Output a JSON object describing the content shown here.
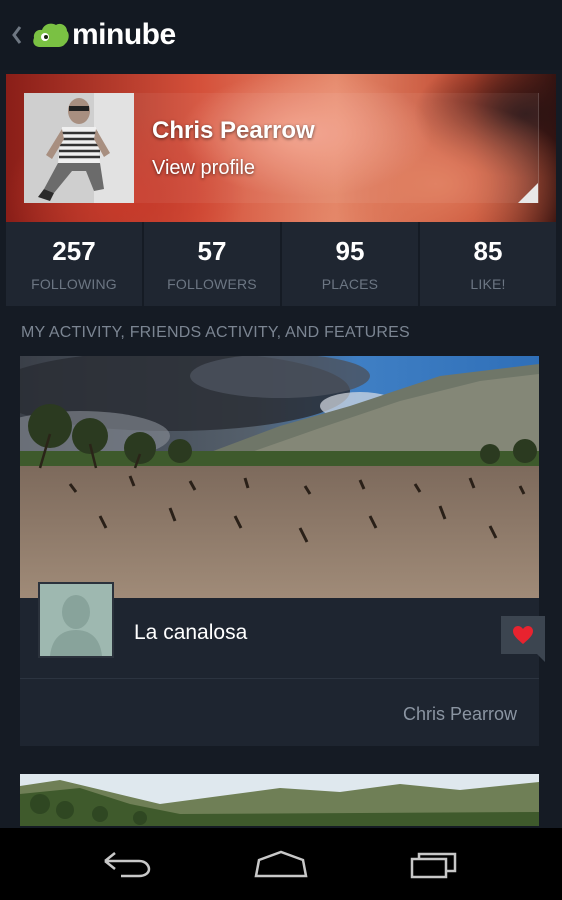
{
  "app": {
    "logo_text": "minube",
    "brand_color": "#7ac143"
  },
  "profile": {
    "name": "Chris Pearrow",
    "view_profile_label": "View profile"
  },
  "stats": [
    {
      "value": "257",
      "label": "FOLLOWING"
    },
    {
      "value": "57",
      "label": "FOLLOWERS"
    },
    {
      "value": "95",
      "label": "PLACES"
    },
    {
      "value": "85",
      "label": "LIKE!"
    }
  ],
  "section": {
    "header": "MY ACTIVITY, FRIENDS ACTIVITY, AND FEATURES"
  },
  "activity": [
    {
      "place": "La canalosa",
      "author": "Chris Pearrow",
      "liked": true,
      "like_color": "#e8232f"
    }
  ],
  "nav": {
    "icons": [
      "back-icon",
      "home-icon",
      "recents-icon"
    ]
  }
}
